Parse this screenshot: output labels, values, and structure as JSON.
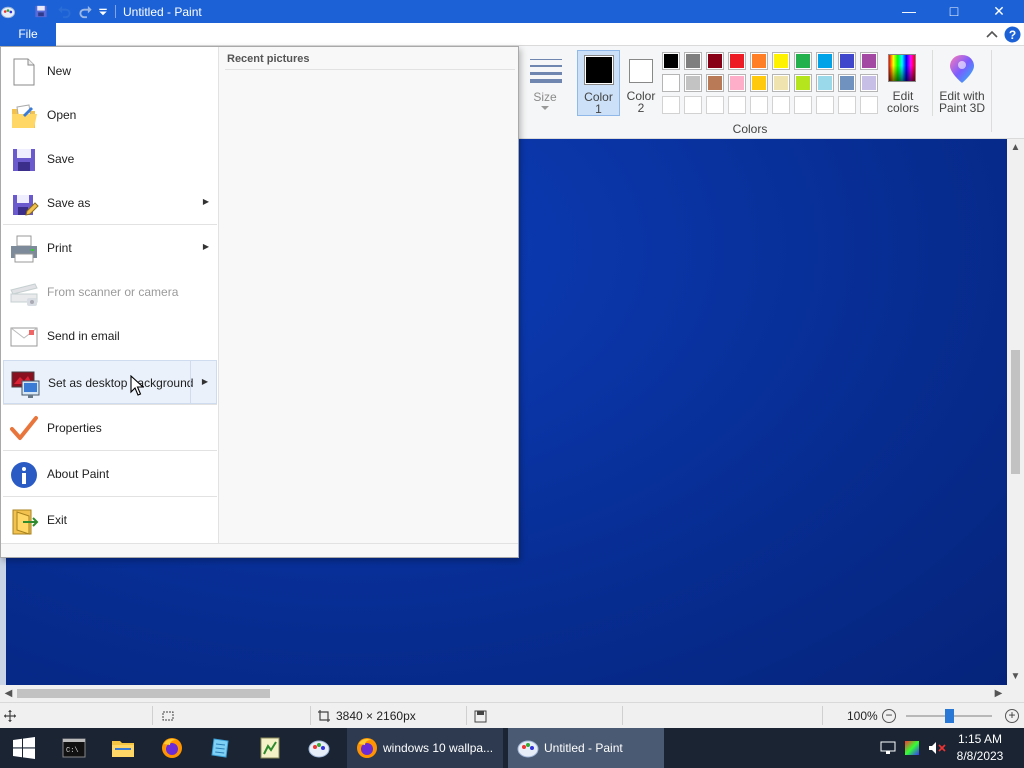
{
  "window": {
    "title": "Untitled - Paint",
    "controls": {
      "minimize": "—",
      "maximize": "□",
      "close": "✕"
    }
  },
  "quick_access": {
    "icons": [
      "paint-app-icon",
      "save-icon",
      "undo-icon",
      "redo-icon",
      "customize-dropdown-icon"
    ]
  },
  "ribbon": {
    "file_tab": "File",
    "size_label": "Size",
    "color1_label": [
      "Color",
      "1"
    ],
    "color2_label": [
      "Color",
      "2"
    ],
    "edit_colors": [
      "Edit",
      "colors"
    ],
    "edit_paint3d": [
      "Edit with",
      "Paint 3D"
    ],
    "colors_group": "Colors",
    "color1_value": "#000000",
    "color2_value": "#ffffff",
    "palette_row1": [
      "#000000",
      "#7f7f7f",
      "#880015",
      "#ed1c24",
      "#ff7f27",
      "#fff200",
      "#22b14c",
      "#00a2e8",
      "#3f48cc",
      "#a349a4"
    ],
    "palette_row2": [
      "#ffffff",
      "#c3c3c3",
      "#b97a57",
      "#ffaec9",
      "#ffc90e",
      "#efe4b0",
      "#b5e61d",
      "#99d9ea",
      "#7092be",
      "#c8bfe7"
    ],
    "palette_row3_count": 10
  },
  "file_menu": {
    "recent_title": "Recent pictures",
    "items": [
      {
        "label": "New",
        "icon": "new-file-icon",
        "submenu": false,
        "enabled": true
      },
      {
        "label": "Open",
        "icon": "open-folder-icon",
        "submenu": false,
        "enabled": true
      },
      {
        "label": "Save",
        "icon": "save-floppy-icon",
        "submenu": false,
        "enabled": true
      },
      {
        "label": "Save as",
        "icon": "save-as-icon",
        "submenu": true,
        "enabled": true
      },
      {
        "label": "Print",
        "icon": "printer-icon",
        "submenu": true,
        "enabled": true
      },
      {
        "label": "From scanner or camera",
        "icon": "scanner-icon",
        "submenu": false,
        "enabled": false
      },
      {
        "label": "Send in email",
        "icon": "email-icon",
        "submenu": false,
        "enabled": true
      },
      {
        "label": "Set as desktop background",
        "icon": "desktop-background-icon",
        "submenu": true,
        "enabled": true,
        "hovered": true
      },
      {
        "label": "Properties",
        "icon": "checkmark-icon",
        "submenu": false,
        "enabled": true
      },
      {
        "label": "About Paint",
        "icon": "info-icon",
        "submenu": false,
        "enabled": true
      },
      {
        "label": "Exit",
        "icon": "exit-icon",
        "submenu": false,
        "enabled": true
      }
    ]
  },
  "statusbar": {
    "dimensions": "3840 × 2160px",
    "zoom": "100%",
    "zoom_level": 0.5
  },
  "taskbar": {
    "pinned": [
      "start-icon",
      "terminal-icon",
      "file-explorer-icon",
      "firefox-icon",
      "notepad-icon",
      "sheet-icon",
      "paint-icon"
    ],
    "tasks": [
      {
        "label": "windows 10 wallpa...",
        "icon": "firefox-icon"
      },
      {
        "label": "Untitled - Paint",
        "icon": "paint-icon",
        "active": true
      }
    ],
    "time": "1:15 AM",
    "date": "8/8/2023"
  }
}
